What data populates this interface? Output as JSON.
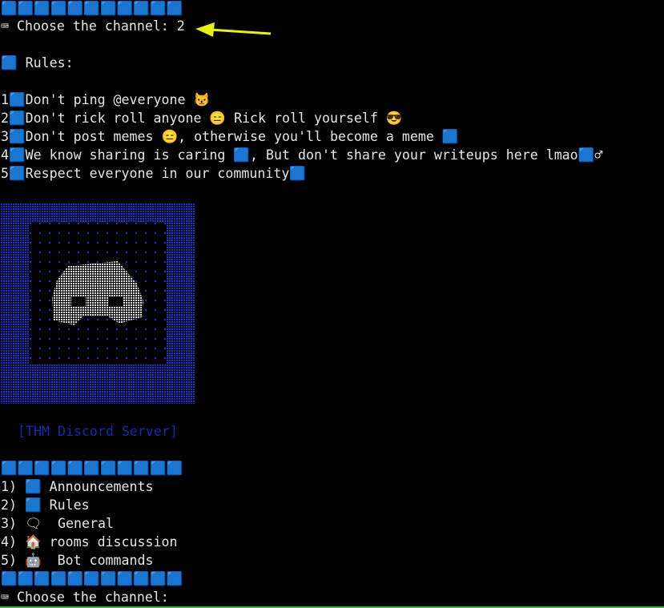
{
  "terminal": {
    "top_border": "🟦🟦🟦🟦🟦🟦🟦🟦🟦🟦🟦",
    "prompt1": "⌨ Choose the channel: 2",
    "rules_heading": "🟦 Rules:",
    "rules": [
      "1🟦Don't ping @everyone 😾",
      "2🟦Don't rick roll anyone 😑 Rick roll yourself 😎",
      "3🟦Don't post memes 😑, otherwise you'll become a meme 🟦",
      "4🟦We know sharing is caring 🟦, But don't share your writeups here lmao🟦♂",
      "5🟦Respect everyone in our community🟦"
    ],
    "server_label": "[THM Discord Server]",
    "menu_border": "🟦🟦🟦🟦🟦🟦🟦🟦🟦🟦🟦",
    "menu": [
      "1) 🟦 Announcements",
      "2) 🟦 Rules",
      "3) 🗨  General",
      "4) 🏠 rooms discussion",
      "5) 🤖  Bot commands"
    ],
    "bottom_border": "🟦🟦🟦🟦🟦🟦🟦🟦🟦🟦🟦",
    "prompt2": "⌨ Choose the channel:"
  },
  "colors": {
    "background": "#000000",
    "text": "#e6e6e6",
    "art_blue": "#1b2fd6",
    "art_white": "#d8d8d8",
    "arrow": "#e6f20f",
    "status_bar": "#27c92a"
  }
}
